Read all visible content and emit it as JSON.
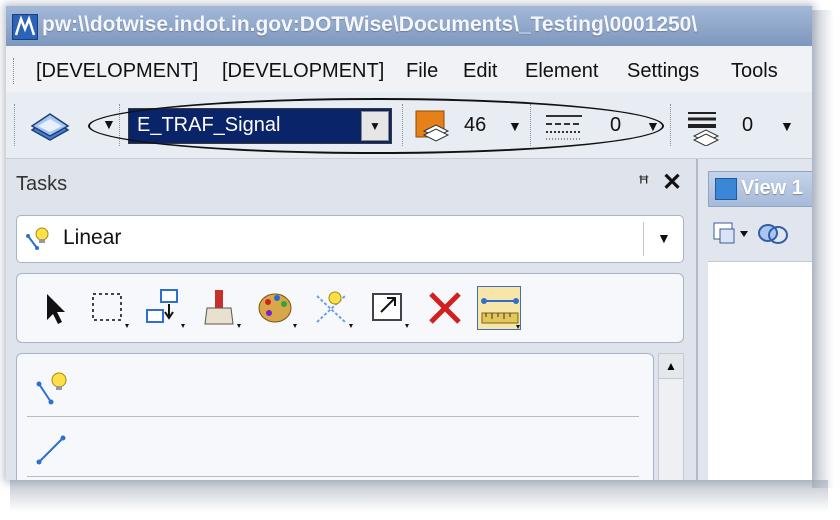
{
  "window": {
    "title": "pw:\\\\dotwise.indot.in.gov:DOTWise\\Documents\\_Testing\\0001250\\"
  },
  "menu": {
    "items": [
      {
        "label": "[DEVELOPMENT]"
      },
      {
        "label": "[DEVELOPMENT]"
      },
      {
        "label": "File"
      },
      {
        "label": "Edit"
      },
      {
        "label": "Element"
      },
      {
        "label": "Settings"
      },
      {
        "label": "Tools"
      }
    ]
  },
  "toolbar": {
    "active_level": "E_TRAF_Signal",
    "color_value": "46",
    "line_style_value": "0",
    "line_weight_value": "0"
  },
  "tasks": {
    "title": "Tasks",
    "pin_glyph": "1",
    "close_glyph": "✕",
    "selected_task": "Linear",
    "tools": [
      {
        "icon": "element-selection-icon"
      },
      {
        "icon": "fence-icon"
      },
      {
        "icon": "group-icon"
      },
      {
        "icon": "change-attributes-icon"
      },
      {
        "icon": "palette-icon"
      },
      {
        "icon": "smart-line-icon"
      },
      {
        "icon": "scale-icon"
      },
      {
        "icon": "delete-icon"
      },
      {
        "icon": "measure-icon"
      }
    ],
    "list": [
      {
        "icon": "smartline-bulb-icon"
      },
      {
        "icon": "place-line-icon"
      }
    ]
  },
  "view": {
    "tab_label": "View 1"
  },
  "colors": {
    "level_highlight": "#0a246a",
    "delete_red": "#d21f1f",
    "title_bar": "#8ea6ca"
  }
}
